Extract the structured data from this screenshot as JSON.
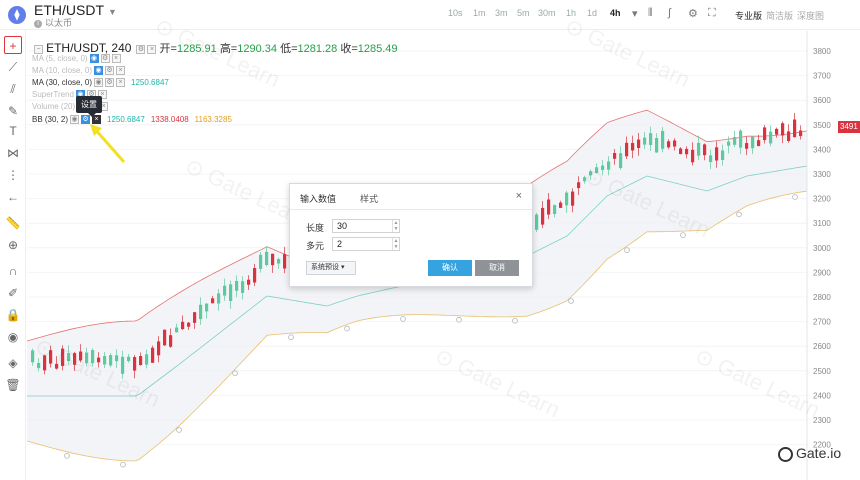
{
  "header": {
    "coin_icon_name": "eth-icon",
    "coin_glyph": "⧫",
    "pair": "ETH/USDT",
    "coin_name": "以太币",
    "intervals": [
      "10s",
      "1m",
      "3m",
      "5m",
      "30m",
      "1h",
      "1d",
      "4h"
    ],
    "active_interval": "4h",
    "views": [
      "专业版",
      "简洁版",
      "深度图"
    ],
    "active_view": "专业版"
  },
  "legend": {
    "title": "ETH/USDT, 240",
    "open_label": "开=",
    "open": "1285.91",
    "high_label": "高=",
    "high": "1290.34",
    "low_label": "低=",
    "low": "1281.28",
    "close_label": "收=",
    "close": "1285.49"
  },
  "indicators": [
    {
      "label": "MA (5, close, 0)",
      "value": ""
    },
    {
      "label": "MA (10, close, 0)",
      "value": ""
    },
    {
      "label": "MA (30, close, 0)",
      "value": "1250.6847"
    },
    {
      "label": "SuperTrend",
      "value": ""
    },
    {
      "label": "Volume (20)",
      "value": ""
    },
    {
      "label": "BB (30, 2)",
      "value": "1250.6847",
      "value2": "1338.0408",
      "value3": "1163.3285"
    }
  ],
  "tooltip": "设置",
  "dialog": {
    "tab_inputs": "输入数值",
    "tab_style": "样式",
    "close": "×",
    "length_label": "长度",
    "length_value": "30",
    "mult_label": "多元",
    "mult_value": "2",
    "preset": "系统预设 ▾",
    "confirm": "确认",
    "cancel": "取消"
  },
  "price_axis": [
    "3800",
    "3700",
    "3600",
    "3500",
    "3400",
    "3300",
    "3200",
    "3100",
    "3000",
    "2900",
    "2800",
    "2700",
    "2600",
    "2500",
    "2400",
    "2300",
    "2200"
  ],
  "current_price": "3491",
  "brand": "Gate.io",
  "colors": {
    "up": "#5cc9a0",
    "down": "#d9333f",
    "band_upper": "#e57373",
    "band_lower": "#e8c070",
    "basis": "#7fd0c8"
  }
}
